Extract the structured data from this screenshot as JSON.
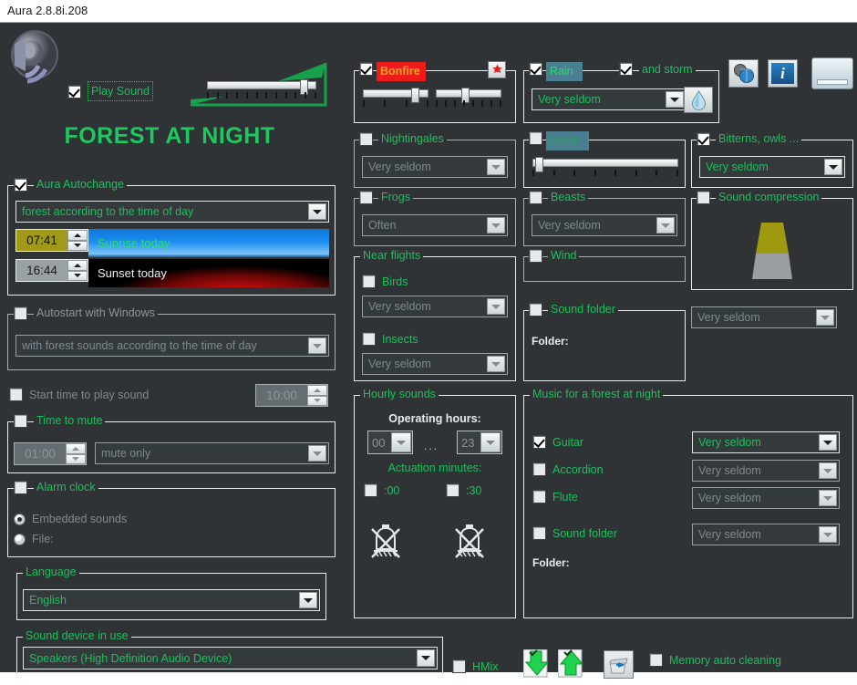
{
  "window": {
    "title": "Aura 2.8.8i.208"
  },
  "header": {
    "play_sound_label": "Play Sound",
    "play_sound_checked": true,
    "preset_title": "FOREST AT NIGHT",
    "speaker_icon": "speaker-icon",
    "volume_percent": 88
  },
  "toolbar": {
    "globe_icon": "globe-icon",
    "info_icon": "info-icon",
    "minimize_icon": "minimize-icon"
  },
  "left": {
    "autochange": {
      "legend": "Aura Autochange",
      "checked": true,
      "mode_value": "forest according to the time of day",
      "sunrise_time": "07:41",
      "sunrise_label": "Sunrise today",
      "sunset_time": "16:44",
      "sunset_label": "Sunset today"
    },
    "autostart": {
      "legend": "Autostart with Windows",
      "checked": false,
      "mode_value": "with forest sounds according to the time of day"
    },
    "start_time": {
      "label": "Start time to play sound",
      "checked": false,
      "value": "10:00"
    },
    "time_to_mute": {
      "legend": "Time to mute",
      "checked": false,
      "value": "01:00",
      "mode_value": "mute only"
    },
    "alarm": {
      "legend": "Alarm clock",
      "checked": false,
      "options": [
        {
          "label": "Embedded sounds",
          "selected": true
        },
        {
          "label": "File:",
          "selected": false
        }
      ]
    },
    "language": {
      "legend": "Language",
      "value": "English"
    }
  },
  "sounds": {
    "bonfire": {
      "label": "Bonfire",
      "checked": true,
      "highlight_bg": "#ee1c18",
      "highlight_fg": "#f0a81e",
      "record_icon": "record-icon",
      "slider1_percent": 76,
      "slider2_percent": 41
    },
    "rain": {
      "label": "Rain",
      "checked": true,
      "highlight_bg": "#4a7f92",
      "storm_label": "and storm",
      "storm_checked": true,
      "frequency": "Very seldom",
      "droplet_icon": "water-drop-icon"
    },
    "nightingales": {
      "label": "Nightingales",
      "checked": false,
      "frequency": "Very seldom"
    },
    "brook": {
      "label": "Brook",
      "checked": false,
      "highlight_bg": "#4a7f92",
      "slider_percent": 3
    },
    "bitterns": {
      "label": "Bitterns, owls ...",
      "checked": true,
      "frequency": "Very seldom"
    },
    "frogs": {
      "label": "Frogs",
      "checked": false,
      "frequency": "Often"
    },
    "beasts": {
      "label": "Beasts",
      "checked": false,
      "frequency": "Very seldom"
    },
    "near_flights": {
      "legend": "Near flights",
      "birds": {
        "label": "Birds",
        "checked": false,
        "frequency": "Very seldom"
      },
      "insects": {
        "label": "Insects",
        "checked": false,
        "frequency": "Very seldom"
      }
    },
    "wind": {
      "label": "Wind",
      "checked": false
    },
    "sound_compression": {
      "label": "Sound compression",
      "checked": false,
      "graphic": "trapezoid-meter"
    },
    "sound_folder": {
      "label": "Sound folder",
      "checked": false,
      "frequency": "Very seldom",
      "folder_label": "Folder:",
      "folder_path": ""
    }
  },
  "hourly": {
    "legend": "Hourly sounds",
    "operating_hours_label": "Operating hours:",
    "hour_from": "00",
    "hour_separator": "...",
    "hour_to": "23",
    "actuation_label": "Actuation minutes:",
    "minute_00": {
      "label": ":00",
      "checked": false
    },
    "minute_30": {
      "label": ":30",
      "checked": false
    },
    "bell_icon": "bell-muted-icon"
  },
  "music": {
    "legend": "Music for a forest at night",
    "items": [
      {
        "label": "Guitar",
        "checked": true,
        "frequency": "Very seldom"
      },
      {
        "label": "Accordion",
        "checked": false,
        "frequency": "Very seldom"
      },
      {
        "label": "Flute",
        "checked": false,
        "frequency": "Very seldom"
      }
    ],
    "sound_folder": {
      "label": "Sound folder",
      "checked": false,
      "frequency": "Very seldom"
    },
    "folder_label": "Folder:",
    "folder_path": ""
  },
  "bottom": {
    "device_legend": "Sound device in use",
    "device_value": "Speakers (High Definition Audio Device)",
    "hmix_label": "HMix",
    "hmix_checked": false,
    "import_icon": "download-green-icon",
    "export_icon": "upload-green-icon",
    "trash_icon": "trash-icon",
    "memory_label": "Memory auto cleaning",
    "memory_checked": false
  }
}
